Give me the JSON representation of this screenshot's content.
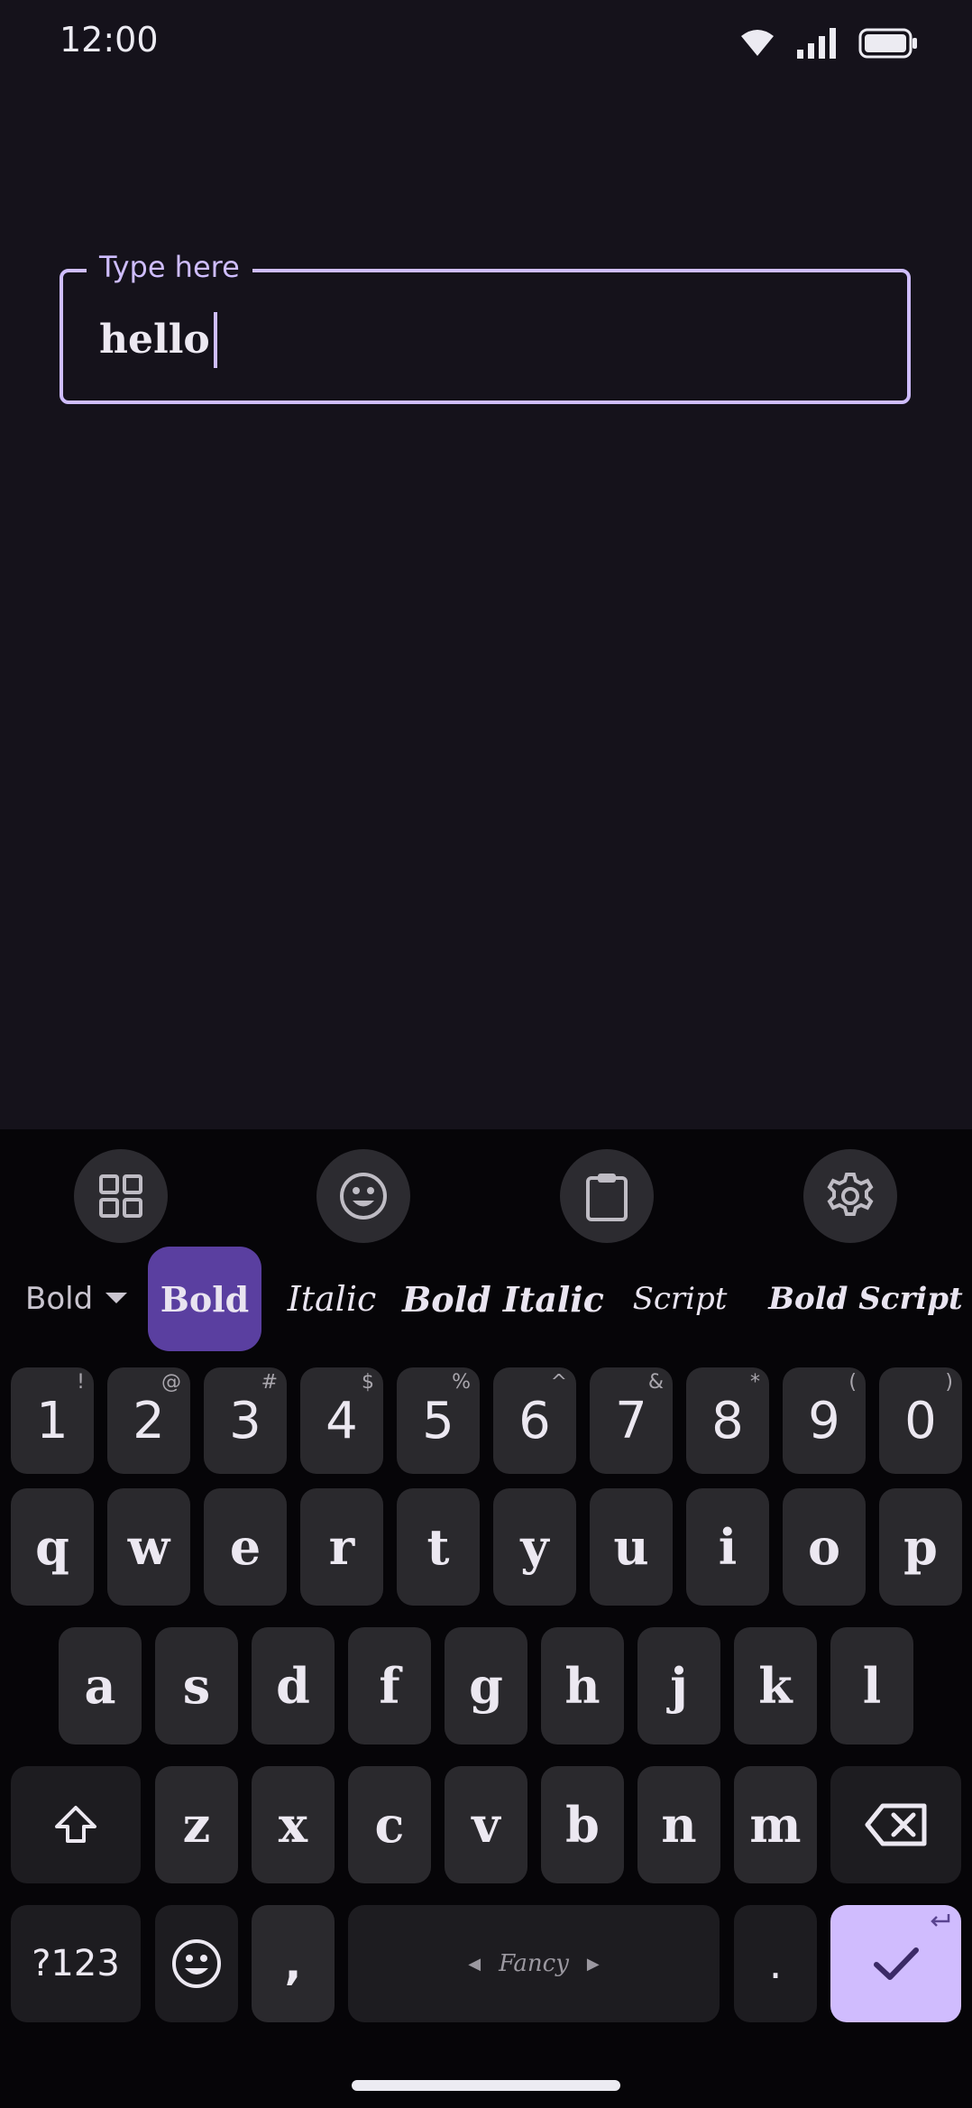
{
  "status_bar": {
    "time": "12:00"
  },
  "text_field": {
    "label": "Type here",
    "value": "hello"
  },
  "keyboard": {
    "style_selector": {
      "current": "Bold"
    },
    "styles": [
      {
        "label": "Bold",
        "selected": true
      },
      {
        "label": "Italic",
        "selected": false
      },
      {
        "label": "Bold Italic",
        "selected": false
      },
      {
        "label": "Script",
        "selected": false
      },
      {
        "label": "Bold Script",
        "selected": false
      }
    ],
    "number_row": [
      {
        "key": "1",
        "hint": "!"
      },
      {
        "key": "2",
        "hint": "@"
      },
      {
        "key": "3",
        "hint": "#"
      },
      {
        "key": "4",
        "hint": "$"
      },
      {
        "key": "5",
        "hint": "%"
      },
      {
        "key": "6",
        "hint": "^"
      },
      {
        "key": "7",
        "hint": "&"
      },
      {
        "key": "8",
        "hint": "*"
      },
      {
        "key": "9",
        "hint": "("
      },
      {
        "key": "0",
        "hint": ")"
      }
    ],
    "row1": [
      "q",
      "w",
      "e",
      "r",
      "t",
      "y",
      "u",
      "i",
      "o",
      "p"
    ],
    "row2": [
      "a",
      "s",
      "d",
      "f",
      "g",
      "h",
      "j",
      "k",
      "l"
    ],
    "row3": [
      "z",
      "x",
      "c",
      "v",
      "b",
      "n",
      "m"
    ],
    "bottom": {
      "symbols": "?123",
      "comma": ",",
      "space": "Fancy",
      "period": "."
    },
    "accent_color": "#d0bcfe"
  }
}
